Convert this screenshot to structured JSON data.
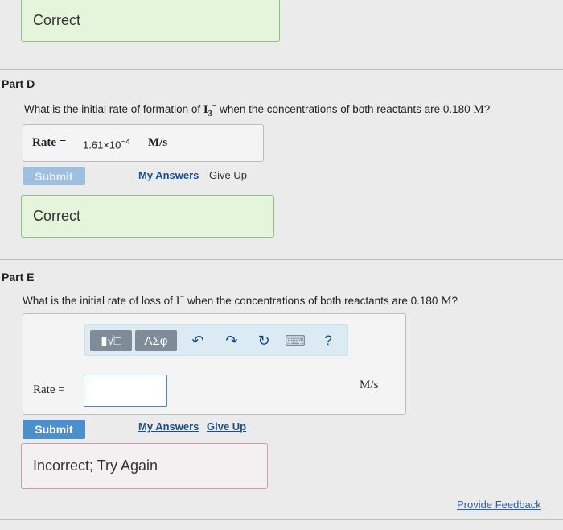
{
  "top_feedback": {
    "text": "Correct"
  },
  "part_d": {
    "title": "Part D",
    "question_pre": "What is the initial rate of formation of ",
    "species_main": "I",
    "species_sub": "3",
    "species_charge": "−",
    "question_mid": " when the concentrations of both reactants are 0.180 ",
    "unit_M": "M",
    "question_end": "?",
    "rate_label": "Rate =",
    "rate_value_base": "1.61×10",
    "rate_value_exp": "−4",
    "rate_units": "M/s",
    "submit_label": "Submit",
    "my_answers_label": "My Answers",
    "give_up_label": "Give Up",
    "feedback": "Correct"
  },
  "part_e": {
    "title": "Part E",
    "question_pre": "What is the initial rate of loss of ",
    "species_main": "I",
    "species_charge": "−",
    "question_mid": " when the concentrations of both reactants are 0.180 ",
    "unit_M": "M",
    "question_end": "?",
    "toolbar": {
      "templates_label": "▮√□",
      "greek_label": "ΑΣφ",
      "undo_glyph": "↶",
      "redo_glyph": "↷",
      "reset_glyph": "↻",
      "keyboard_glyph": "⌨",
      "help_glyph": "?"
    },
    "rate_label": "Rate =",
    "rate_value": "",
    "rate_units": "M/s",
    "submit_label": "Submit",
    "my_answers_label": "My Answers",
    "give_up_label": "Give Up",
    "feedback": "Incorrect; Try Again"
  },
  "footer": {
    "provide_feedback_label": "Provide Feedback"
  }
}
